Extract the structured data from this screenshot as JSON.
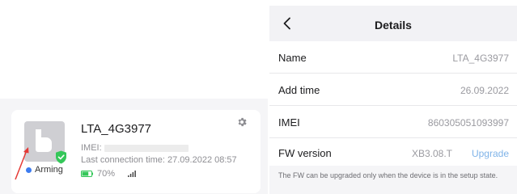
{
  "device_card": {
    "name": "LTA_4G3977",
    "imei_label": "IMEI:",
    "last_connection": "Last connection time: 27.09.2022 08:57",
    "battery": "70%",
    "battery_level": 0.7,
    "status": "Arming"
  },
  "details": {
    "title": "Details",
    "rows": [
      {
        "label": "Name",
        "value": "LTA_4G3977"
      },
      {
        "label": "Add time",
        "value": "26.09.2022"
      },
      {
        "label": "IMEI",
        "value": "860305051093997"
      },
      {
        "label": "FW version",
        "value": "XB3.08.T"
      }
    ],
    "upgrade_label": "Upgrade",
    "note": "The FW can be upgraded only when the device is in the setup state."
  },
  "colors": {
    "status_dot": "#3d7cf0",
    "shield": "#34c759",
    "battery": "#34c759",
    "upgrade_link": "#7fb3e8",
    "annotation_arrow": "#e53935"
  }
}
